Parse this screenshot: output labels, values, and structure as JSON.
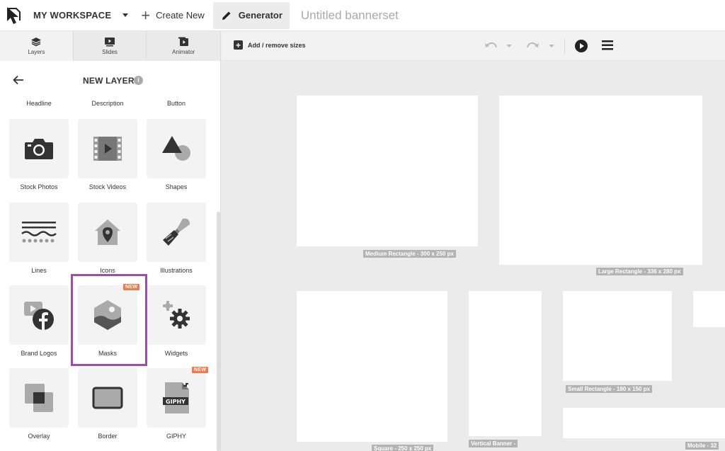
{
  "topbar": {
    "workspace": "MY WORKSPACE",
    "create_new": "Create New",
    "generator": "Generator",
    "bannerset_title": "Untitled bannerset"
  },
  "tabs": [
    {
      "label": "Layers",
      "icon": "layers-icon"
    },
    {
      "label": "Slides",
      "icon": "slides-icon"
    },
    {
      "label": "Animator",
      "icon": "animator-icon"
    }
  ],
  "panel": {
    "title": "NEW LAYER",
    "text_items": [
      "Headline",
      "Description",
      "Button"
    ],
    "tiles": [
      {
        "label": "Stock Photos",
        "icon": "camera-icon"
      },
      {
        "label": "Stock Videos",
        "icon": "film-icon"
      },
      {
        "label": "Shapes",
        "icon": "shapes-icon"
      },
      {
        "label": "Lines",
        "icon": "lines-icon"
      },
      {
        "label": "Icons",
        "icon": "house-pin-icon"
      },
      {
        "label": "Illustrations",
        "icon": "paintbrush-icon"
      },
      {
        "label": "Brand Logos",
        "icon": "facebook-logo-icon"
      },
      {
        "label": "Masks",
        "icon": "hexagon-image-icon",
        "badge": "NEW"
      },
      {
        "label": "Widgets",
        "icon": "gear-icon"
      },
      {
        "label": "Overlay",
        "icon": "overlay-icon"
      },
      {
        "label": "Border",
        "icon": "border-icon"
      },
      {
        "label": "GIPHY",
        "icon": "giphy-file-icon",
        "badge": "NEW"
      }
    ]
  },
  "toolbar": {
    "add_remove": "Add / remove sizes"
  },
  "banners": [
    {
      "label": "Medium Rectangle - 300 x 250 px"
    },
    {
      "label": "Large Rectangle - 336 x 280 px"
    },
    {
      "label": "Square - 250 x 250 px"
    },
    {
      "label": "Vertical Banner -"
    },
    {
      "label": "Small Rectangle - 180 x 150 px"
    },
    {
      "label": "Mobile - 32"
    }
  ],
  "colors": {
    "highlight": "#9b4fa8",
    "badge": "#f07a4a"
  }
}
